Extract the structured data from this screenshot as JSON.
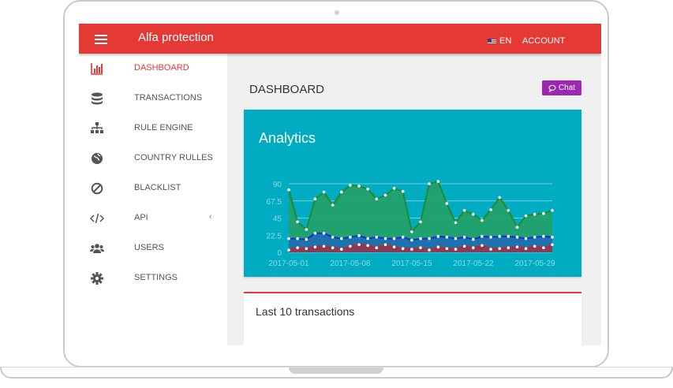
{
  "app": {
    "title": "Alfa protection",
    "lang": "EN",
    "account": "ACCOUNT"
  },
  "sidebar": {
    "items": [
      {
        "label": "DASHBOARD",
        "icon": "bar-chart-icon",
        "active": true
      },
      {
        "label": "TRANSACTIONS",
        "icon": "database-icon"
      },
      {
        "label": "RULE ENGINE",
        "icon": "sitemap-icon"
      },
      {
        "label": "COUNTRY RULLES",
        "icon": "globe-icon"
      },
      {
        "label": "BLACKLIST",
        "icon": "ban-icon"
      },
      {
        "label": "API",
        "icon": "code-icon",
        "chevron": "‹"
      },
      {
        "label": "USERS",
        "icon": "users-icon"
      },
      {
        "label": "SETTINGS",
        "icon": "gear-icon"
      }
    ]
  },
  "main": {
    "title": "DASHBOARD",
    "chat_label": "Chat",
    "analytics_title": "Analytics",
    "transactions_title": "Last 10 transactions"
  },
  "colors": {
    "accent": "#e53935",
    "chat": "#9c27b0",
    "panel": "#00acc1"
  },
  "chart_data": {
    "type": "area",
    "x_ticks": [
      "2017-05-01",
      "2017-05-08",
      "2017-05-15",
      "2017-05-22",
      "2017-05-29"
    ],
    "y_ticks": [
      "0",
      "22.5",
      "45",
      "67.5",
      "90"
    ],
    "ylim": [
      0,
      90
    ],
    "x_start": "2017-05-01",
    "x_end": "2017-05-31",
    "series": [
      {
        "color": "#1f8b2e",
        "fill": "#22a06b",
        "values": [
          82,
          40,
          30,
          70,
          79,
          62,
          79,
          88,
          87,
          83,
          70,
          75,
          84,
          80,
          27,
          40,
          90,
          93,
          64,
          39,
          55,
          50,
          42,
          56,
          72,
          55,
          33,
          48,
          50,
          51,
          55
        ]
      },
      {
        "color": "#1030d8",
        "fill": "#1e6fb0",
        "values": [
          18,
          18,
          17,
          25,
          25,
          20,
          18,
          20,
          22,
          18,
          20,
          18,
          18,
          20,
          16,
          18,
          18,
          21,
          20,
          18,
          20,
          17,
          21,
          20,
          21,
          21,
          20,
          18,
          20,
          21,
          20
        ]
      },
      {
        "color": "#cc2222",
        "fill": "#8b3a55",
        "values": [
          3,
          6,
          5,
          7,
          8,
          6,
          4,
          8,
          10,
          9,
          6,
          10,
          7,
          5,
          4,
          6,
          3,
          7,
          5,
          4,
          8,
          6,
          9,
          4,
          5,
          6,
          7,
          5,
          8,
          6,
          10
        ]
      }
    ]
  }
}
